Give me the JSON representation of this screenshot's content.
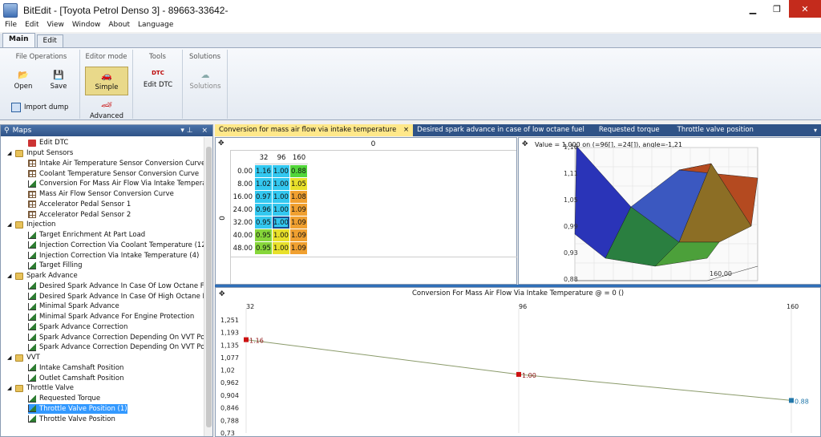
{
  "window": {
    "title": "BitEdit - [Toyota Petrol Denso 3] - 89663-33642-"
  },
  "menu": [
    "File",
    "Edit",
    "View",
    "Window",
    "About",
    "Language"
  ],
  "ribbon_tabs": [
    {
      "label": "Main",
      "active": true
    },
    {
      "label": "Edit",
      "active": false
    }
  ],
  "ribbon": {
    "file_ops": {
      "title": "File Operations",
      "open": "Open",
      "save": "Save",
      "import": "Import dump"
    },
    "editor_mode": {
      "title": "Editor mode",
      "simple": "Simple",
      "advanced": "Advanced"
    },
    "tools": {
      "title": "Tools",
      "edit_dtc": "Edit DTC",
      "dtc_badge": "DTC"
    },
    "solutions": {
      "title": "Solutions",
      "solutions": "Solutions"
    }
  },
  "maps_panel": {
    "title": "Maps",
    "pin": "▾ ⊥",
    "close": "×",
    "rows": [
      {
        "label": "Edit DTC",
        "indent": 1,
        "icon": "dtc",
        "sel": false
      },
      {
        "label": "Input Sensors",
        "indent": 0,
        "icon": "folder",
        "sel": false
      },
      {
        "label": "Intake Air Temperature Sensor Conversion Curve",
        "indent": 1,
        "icon": "table",
        "sel": false
      },
      {
        "label": "Coolant Temperature Sensor Conversion Curve",
        "indent": 1,
        "icon": "table",
        "sel": false
      },
      {
        "label": "Conversion For Mass Air Flow Via Intake Temperatu",
        "indent": 1,
        "icon": "chart",
        "sel": false
      },
      {
        "label": "Mass Air Flow Sensor Conversion Curve",
        "indent": 1,
        "icon": "table",
        "sel": false
      },
      {
        "label": "Accelerator Pedal Sensor 1",
        "indent": 1,
        "icon": "table",
        "sel": false
      },
      {
        "label": "Accelerator Pedal Sensor 2",
        "indent": 1,
        "icon": "table",
        "sel": false
      },
      {
        "label": "Injection",
        "indent": 0,
        "icon": "folder",
        "sel": false
      },
      {
        "label": "Target Enrichment At Part Load",
        "indent": 1,
        "icon": "chart",
        "sel": false
      },
      {
        "label": "Injection Correction Via Coolant Temperature (12)",
        "indent": 1,
        "icon": "chart",
        "sel": false
      },
      {
        "label": "Injection Correction Via Intake Temperature (4)",
        "indent": 1,
        "icon": "chart",
        "sel": false
      },
      {
        "label": "Target Filling",
        "indent": 1,
        "icon": "chart",
        "sel": false
      },
      {
        "label": "Spark Advance",
        "indent": 0,
        "icon": "folder",
        "sel": false
      },
      {
        "label": "Desired Spark Advance In Case Of Low Octane Fuel",
        "indent": 1,
        "icon": "chart",
        "sel": false
      },
      {
        "label": "Desired Spark Advance In Case Of High Octane Fue",
        "indent": 1,
        "icon": "chart",
        "sel": false
      },
      {
        "label": "Minimal Spark Advance",
        "indent": 1,
        "icon": "chart",
        "sel": false
      },
      {
        "label": "Minimal Spark Advance For Engine Protection",
        "indent": 1,
        "icon": "chart",
        "sel": false
      },
      {
        "label": "Spark Advance Correction",
        "indent": 1,
        "icon": "chart",
        "sel": false
      },
      {
        "label": "Spark Advance Correction Depending On VVT Posit",
        "indent": 1,
        "icon": "chart",
        "sel": false
      },
      {
        "label": "Spark Advance Correction Depending On VVT Posit",
        "indent": 1,
        "icon": "chart",
        "sel": false
      },
      {
        "label": "VVT",
        "indent": 0,
        "icon": "folder",
        "sel": false
      },
      {
        "label": "Intake Camshaft Position",
        "indent": 1,
        "icon": "chart",
        "sel": false
      },
      {
        "label": "Outlet Camshaft Position",
        "indent": 1,
        "icon": "chart",
        "sel": false
      },
      {
        "label": "Throttle Valve",
        "indent": 0,
        "icon": "folder",
        "sel": false
      },
      {
        "label": "Requested Torque",
        "indent": 1,
        "icon": "chart",
        "sel": false
      },
      {
        "label": "Throttle Valve Position (1)",
        "indent": 1,
        "icon": "chart",
        "sel": true
      },
      {
        "label": "Throttle Valve Position",
        "indent": 1,
        "icon": "chart",
        "sel": false
      }
    ]
  },
  "doc_tabs": [
    {
      "label": "Conversion for mass air flow via intake temperature",
      "active": true
    },
    {
      "label": "Desired spark advance in case of low octane fuel",
      "active": false
    },
    {
      "label": "Requested torque",
      "active": false
    },
    {
      "label": "Throttle valve position",
      "active": false
    }
  ],
  "doc_tab_close": "×",
  "table": {
    "header_value": "0",
    "side_label": "0",
    "col_headers": [
      "32",
      "96",
      "160"
    ],
    "row_headers": [
      "0.00",
      "8.00",
      "16.00",
      "24.00",
      "32.00",
      "40.00",
      "48.00"
    ],
    "cells": [
      [
        "1.16",
        "1.00",
        "0.88"
      ],
      [
        "1.02",
        "1.00",
        "1.05"
      ],
      [
        "0.97",
        "1.00",
        "1.08"
      ],
      [
        "0.96",
        "1.00",
        "1.09"
      ],
      [
        "0.95",
        "1.00",
        "1.09"
      ],
      [
        "0.95",
        "1.00",
        "1.09"
      ],
      [
        "0.95",
        "1.00",
        "1.09"
      ]
    ],
    "cell_colors": [
      [
        "#33c8f0",
        "#33c8f0",
        "#52d63a"
      ],
      [
        "#33c8f0",
        "#33c8f0",
        "#e8e02a"
      ],
      [
        "#33c8f0",
        "#33c8f0",
        "#f0a030"
      ],
      [
        "#33c8f0",
        "#33c8f0",
        "#f0a030"
      ],
      [
        "#33c8f0",
        "#33c8f0",
        "#f0a030"
      ],
      [
        "#86d63a",
        "#e8e02a",
        "#f0a030"
      ],
      [
        "#86d63a",
        "#e8e02a",
        "#f0a030"
      ]
    ],
    "selected_cell": [
      4,
      1
    ]
  },
  "surface": {
    "info": "Value = 1,000  on (=96[], =24[]), angle=-1,21",
    "z_ticks": [
      "1,16",
      "1,11",
      "1,05",
      "0,99",
      "0,93",
      "0,88"
    ],
    "x_tick": "160,00"
  },
  "chart_data": {
    "type": "line",
    "title": "Conversion For Mass Air Flow Via Intake Temperature @  = 0 ()",
    "x": [
      32,
      96,
      160
    ],
    "x_ticks": [
      "32",
      "96",
      "160"
    ],
    "y_ticks": [
      "1,251",
      "1,193",
      "1,135",
      "1,077",
      "1,02",
      "0,962",
      "0,904",
      "0,846",
      "0,788",
      "0,73"
    ],
    "ylim": [
      0.73,
      1.251
    ],
    "series": [
      {
        "values": [
          1.16,
          1.0,
          0.88
        ],
        "labels": [
          "1.16",
          "1.00",
          "0.88"
        ]
      }
    ],
    "line_color": "#8a9a6a",
    "point_color": "#cc1111",
    "selected_point_color": "#2277aa"
  }
}
